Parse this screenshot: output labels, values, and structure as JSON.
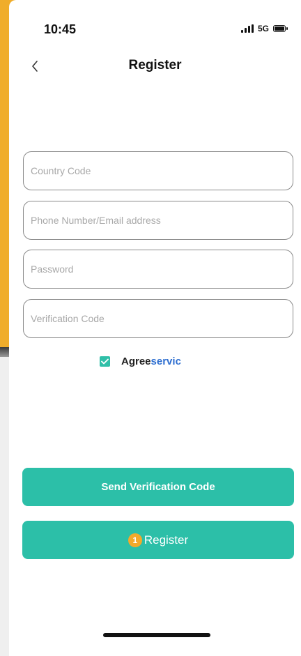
{
  "status_bar": {
    "time": "10:45",
    "network": "5G"
  },
  "header": {
    "title": "Register"
  },
  "form": {
    "country_code": {
      "placeholder": "Country Code",
      "value": ""
    },
    "phone_email": {
      "placeholder": "Phone Number/Email address",
      "value": ""
    },
    "password": {
      "placeholder": "Password",
      "value": ""
    },
    "verification_code": {
      "placeholder": "Verification Code",
      "value": ""
    }
  },
  "agreement": {
    "checked": true,
    "text": "Agree",
    "link_text": "servic"
  },
  "buttons": {
    "send_code_label": "Send Verification Code",
    "register_label": "Register",
    "register_badge": "1"
  },
  "colors": {
    "accent": "#2cbfa8",
    "link": "#2f6fd0",
    "badge": "#f4a92a",
    "frame": "#f0ad2b"
  },
  "icons": {
    "back": "chevron-left-icon",
    "signal": "signal-icon",
    "battery": "battery-icon",
    "checkbox": "checkmark-icon"
  }
}
